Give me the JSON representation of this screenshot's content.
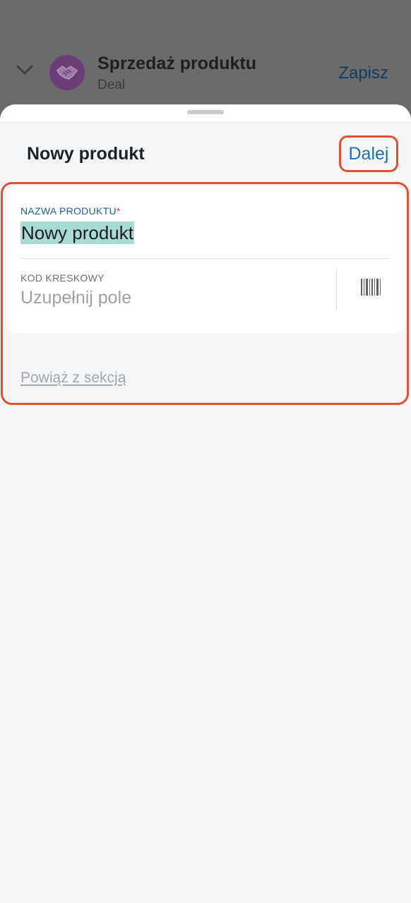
{
  "background": {
    "title": "Sprzedaż produktu",
    "subtitle": "Deal",
    "save_label": "Zapisz"
  },
  "sheet": {
    "title": "Nowy produkt",
    "next_label": "Dalej",
    "fields": {
      "name": {
        "label": "NAZWA PRODUKTU",
        "required_mark": "*",
        "value": "Nowy produkt"
      },
      "barcode": {
        "label": "KOD KRESKOWY",
        "placeholder": "Uzupełnij pole"
      }
    },
    "link_section_label": "Powiąż z sekcją"
  },
  "colors": {
    "accent_blue": "#1f6fa8",
    "highlight_red": "#e14f2e",
    "selection": "#a8dbd3",
    "required": "#e0393e"
  },
  "icons": {
    "collapse": "chevron-down-icon",
    "deal": "handshake-icon",
    "barcode": "barcode-icon"
  }
}
